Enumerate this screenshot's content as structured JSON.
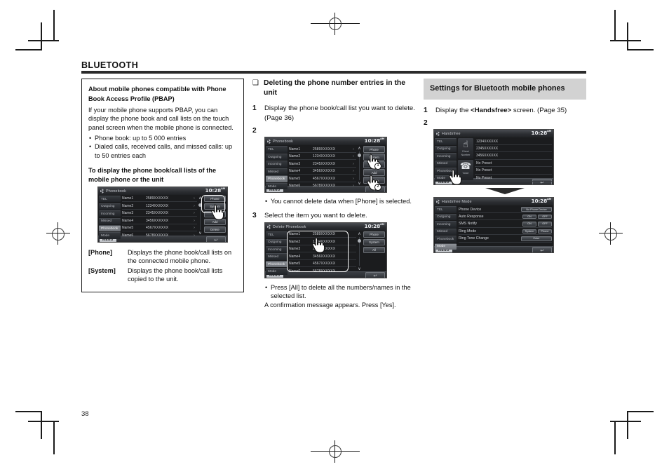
{
  "page": {
    "chapter": "BLUETOOTH",
    "folio": "38"
  },
  "note_box": {
    "title_line1": "About mobile phones compatible with Phone",
    "title_line2": "Book Access Profile (PBAP)",
    "paragraph": "If your mobile phone supports PBAP, you can display the phone book and call lists on the touch panel screen when the mobile phone is connected.",
    "bullets": [
      "Phone book: up to 5 000 entries",
      "Dialed calls, received calls, and missed calls: up to 50 entries each"
    ],
    "sub_head": "To display the phone book/call lists of the mobile phone or the unit",
    "definitions": [
      {
        "key": "[Phone]",
        "value": "Displays the phone book/call lists on the connected mobile phone."
      },
      {
        "key": "[System]",
        "value": "Displays the phone book/call lists copied to the unit."
      }
    ]
  },
  "col2": {
    "heading_glyph": "❑",
    "heading": "Deleting the phone number entries in the unit",
    "step1_num": "1",
    "step1_text": "Display the phone book/call list you want to delete. (Page 36)",
    "step2_num": "2",
    "step2_note_bullet": "You cannot delete data when [Phone] is selected.",
    "step3_num": "3",
    "step3_text": "Select the item you want to delete.",
    "step3_bullet": "Press [All] to delete all the numbers/names in the selected list.",
    "step3_plain": "A confirmation message appears. Press [Yes]."
  },
  "col3": {
    "section_title": "Settings for Bluetooth mobile phones",
    "step1_num": "1",
    "step1_text_a": "Display the ",
    "step1_text_b": "<Handsfree>",
    "step1_text_c": " screen. (Page 35)",
    "step2_num": "2"
  },
  "screens": {
    "phonebook": {
      "title": "Phonebook",
      "clock": "10:28",
      "clock_ampm": "AM",
      "nav": [
        "TEL",
        "Outgoing",
        "Incoming",
        "Missed",
        "Phonebook",
        "Mode"
      ],
      "nav_active_index": 4,
      "rows": [
        {
          "name": "Name1",
          "number": "2589XXXXXX",
          "arrow": "›"
        },
        {
          "name": "Name2",
          "number": "1234XXXXXX",
          "arrow": "›"
        },
        {
          "name": "Name3",
          "number": "2345XXXXXX",
          "arrow": "›"
        },
        {
          "name": "Name4",
          "number": "3456XXXXXX",
          "arrow": "›"
        },
        {
          "name": "Name5",
          "number": "4567XXXXXX",
          "arrow": "›"
        },
        {
          "name": "Name6",
          "number": "5678XXXXXX",
          "arrow": "›"
        }
      ],
      "buttons": [
        "Phone",
        "System",
        "A-Z",
        "Add",
        "Delete"
      ],
      "menu_label": "MENU",
      "back_glyph": "↩",
      "scroll_up": "∧",
      "scroll_down": "∨"
    },
    "delete_phonebook": {
      "title": "Delete Phonebook",
      "clock": "10:28",
      "clock_ampm": "AM",
      "nav": [
        "TEL",
        "Outgoing",
        "Incoming",
        "Missed",
        "Phonebook",
        "Mode"
      ],
      "nav_active_index": 4,
      "rows": [
        {
          "name": "Name1",
          "number": "2589XXXXXX"
        },
        {
          "name": "Name2",
          "number": "1234XXXXXX"
        },
        {
          "name": "Name3",
          "number": "2345XXXXXX"
        },
        {
          "name": "Name4",
          "number": "3456XXXXXX"
        },
        {
          "name": "Name5",
          "number": "4567XXXXXX"
        },
        {
          "name": "Name6",
          "number": "5678XXXXXX"
        }
      ],
      "buttons": [
        "Phone",
        "System",
        "All"
      ],
      "menu_label": "MENU",
      "back_glyph": "↩",
      "scroll_up": "∧",
      "scroll_down": "∨"
    },
    "handsfree": {
      "title": "Handsfree",
      "clock": "10:28",
      "clock_ampm": "AM",
      "nav": [
        "TEL",
        "Outgoing",
        "Incoming",
        "Missed",
        "Phonebook",
        "Mode"
      ],
      "nav_active_index": -1,
      "tiles": [
        {
          "glyph": "☝",
          "caption_line1": "Direct",
          "caption_line2": "Number"
        },
        {
          "glyph": "☎",
          "caption_line1": "Voice",
          "caption_line2": ""
        }
      ],
      "rows": [
        "1234XXXXXX",
        "2345XXXXXX",
        "3456XXXXXX",
        "No Preset",
        "No Preset",
        "No Preset"
      ],
      "menu_label": "MENU",
      "back_glyph": "↩"
    },
    "handsfree_mode": {
      "title": "Handsfree Mode",
      "clock": "10:28",
      "clock_ampm": "AM",
      "nav": [
        "TEL",
        "Outgoing",
        "Incoming",
        "Missed",
        "Phonebook",
        "Mode"
      ],
      "nav_active_index": 5,
      "settings": [
        {
          "label": "Phone Device",
          "controls": [
            {
              "text": "No Phone Device",
              "size": "w-wide"
            }
          ]
        },
        {
          "label": "Auto Response",
          "controls": [
            {
              "text": "ON",
              "size": "w-mid"
            },
            {
              "text": "OFF",
              "size": "w-mid"
            }
          ]
        },
        {
          "label": "SMS Notify",
          "controls": [
            {
              "text": "ON",
              "size": "w-mid"
            },
            {
              "text": "OFF",
              "size": "w-mid"
            }
          ]
        },
        {
          "label": "Ring Mode",
          "controls": [
            {
              "text": "System",
              "size": "w-mid"
            },
            {
              "text": "Phone",
              "size": "w-mid"
            }
          ]
        },
        {
          "label": "Ring Tone Change",
          "controls": [
            {
              "text": "Enter",
              "size": "w-enter"
            }
          ]
        }
      ],
      "menu_label": "MENU",
      "back_glyph": "↩"
    }
  },
  "hand_badges": {
    "one": "1",
    "two": "2"
  }
}
